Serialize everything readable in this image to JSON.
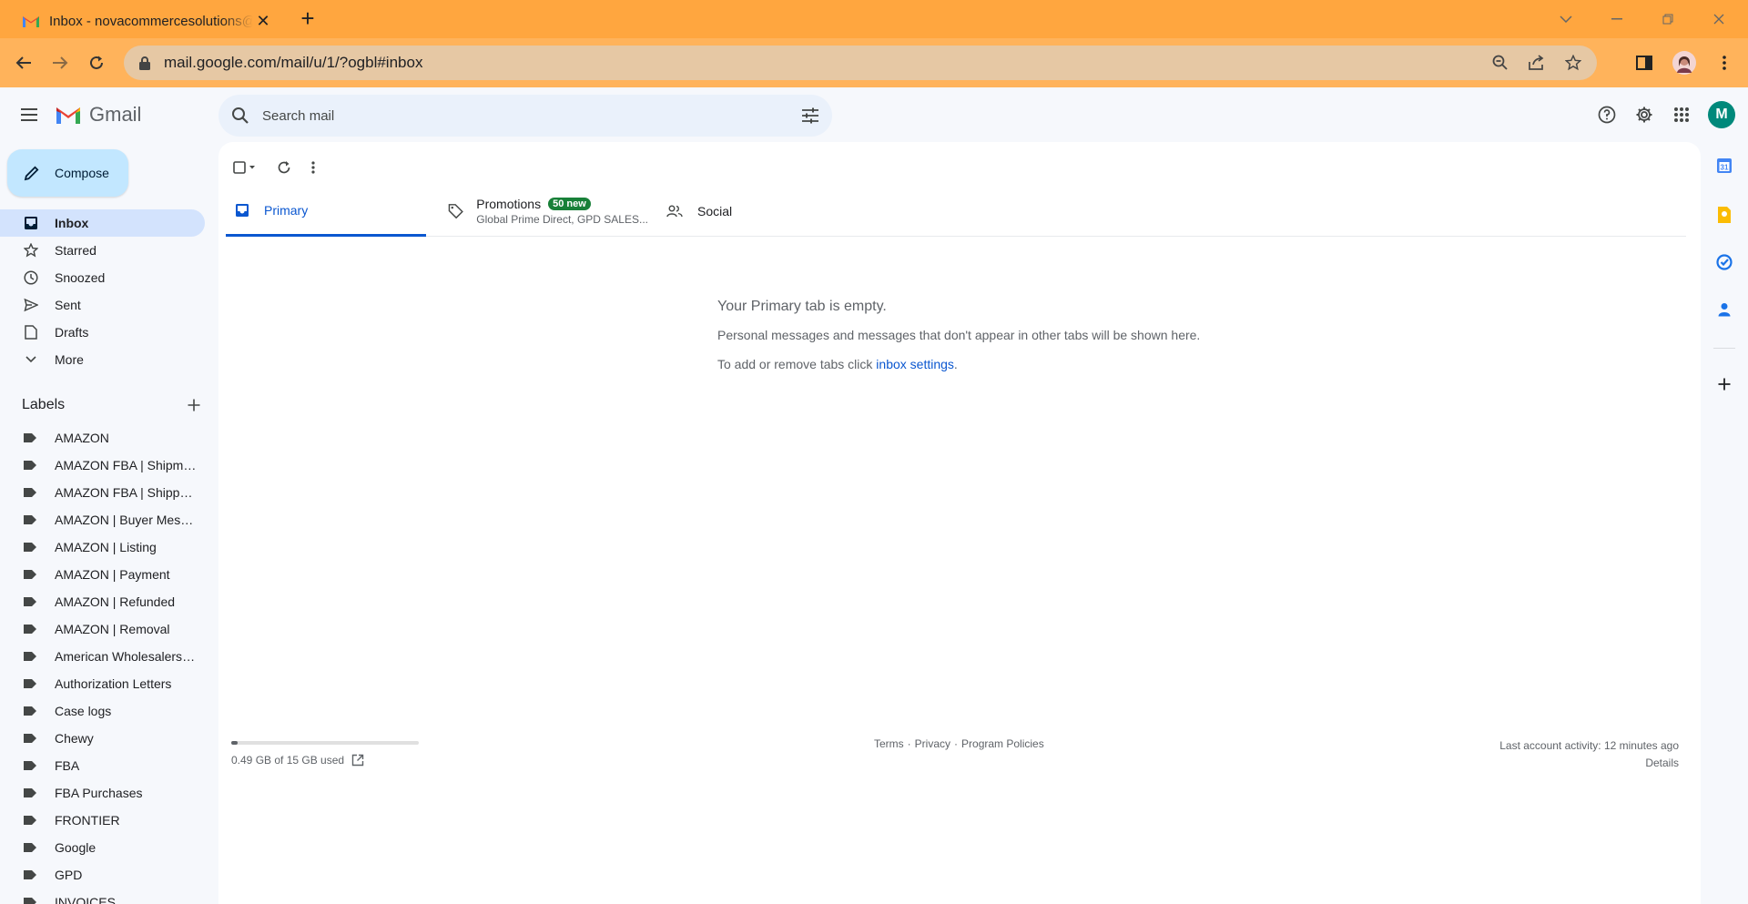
{
  "browser": {
    "tab_title": "Inbox - novacommercesolutions@",
    "url": "mail.google.com/mail/u/1/?ogbl#inbox"
  },
  "gmail": {
    "product_name": "Gmail",
    "search_placeholder": "Search mail",
    "account_initial": "M"
  },
  "sidebar": {
    "compose_label": "Compose",
    "nav": [
      {
        "label": "Inbox",
        "icon": "inbox-icon",
        "active": true
      },
      {
        "label": "Starred",
        "icon": "star-icon"
      },
      {
        "label": "Snoozed",
        "icon": "clock-icon"
      },
      {
        "label": "Sent",
        "icon": "send-icon"
      },
      {
        "label": "Drafts",
        "icon": "draft-icon"
      },
      {
        "label": "More",
        "icon": "chevron-down-icon"
      }
    ],
    "labels_heading": "Labels",
    "labels": [
      "AMAZON",
      "AMAZON FBA | Shipmen...",
      "AMAZON FBA | Shipped...",
      "AMAZON | Buyer Messa...",
      "AMAZON | Listing",
      "AMAZON | Payment",
      "AMAZON | Refunded",
      "AMAZON | Removal",
      "American Wholesalers L...",
      "Authorization Letters",
      "Case logs",
      "Chewy",
      "FBA",
      "FBA Purchases",
      "FRONTIER",
      "Google",
      "GPD",
      "INVOICES"
    ]
  },
  "tabs": {
    "primary": "Primary",
    "promotions": "Promotions",
    "promotions_badge": "50 new",
    "promotions_sub": "Global Prime Direct, GPD SALES...",
    "social": "Social"
  },
  "empty_state": {
    "heading": "Your Primary tab is empty.",
    "line1": "Personal messages and messages that don't appear in other tabs will be shown here.",
    "line2_prefix": "To add or remove tabs click ",
    "line2_link": "inbox settings",
    "line2_suffix": "."
  },
  "footer": {
    "storage_used_fraction": 0.033,
    "storage_text": "0.49 GB of 15 GB used",
    "terms": "Terms",
    "privacy": "Privacy",
    "policies": "Program Policies",
    "sep": "·",
    "last_activity": "Last account activity: 12 minutes ago",
    "details": "Details"
  },
  "colors": {
    "browser_frame": "#ffa63f",
    "accent": "#0b57d0",
    "compose_bg": "#c2e7ff",
    "active_nav": "#d3e3fd",
    "badge": "#188038",
    "avatar": "#00897b"
  }
}
